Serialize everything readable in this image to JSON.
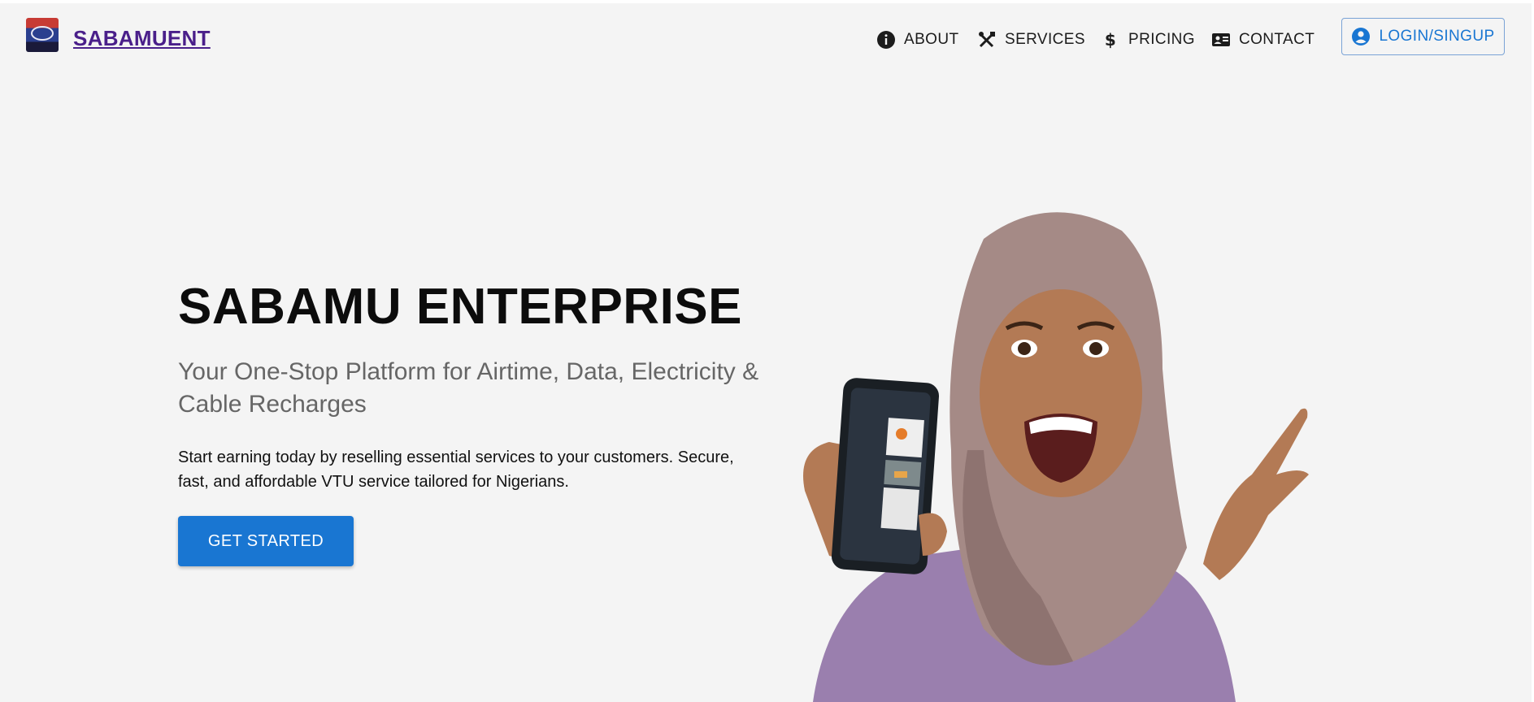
{
  "header": {
    "brand": "SABAMUENT",
    "logo_icon": "sabamu-enterprise-logo",
    "nav": [
      {
        "label": "ABOUT",
        "icon": "info-icon"
      },
      {
        "label": "SERVICES",
        "icon": "tools-icon"
      },
      {
        "label": "PRICING",
        "icon": "dollar-icon"
      },
      {
        "label": "CONTACT",
        "icon": "contact-card-icon"
      }
    ],
    "login_label": "LOGIN/SINGUP",
    "login_icon": "account-circle-icon"
  },
  "hero": {
    "title": "SABAMU ENTERPRISE",
    "subtitle": "Your One-Stop Platform for Airtime, Data, Electricity & Cable Recharges",
    "body": "Start earning today by reselling essential services to your customers. Secure, fast, and affordable VTU service tailored for Nigerians.",
    "cta_label": "GET STARTED"
  },
  "colors": {
    "brand": "#4a1f8a",
    "accent": "#1976d2",
    "background": "#f4f4f4"
  }
}
